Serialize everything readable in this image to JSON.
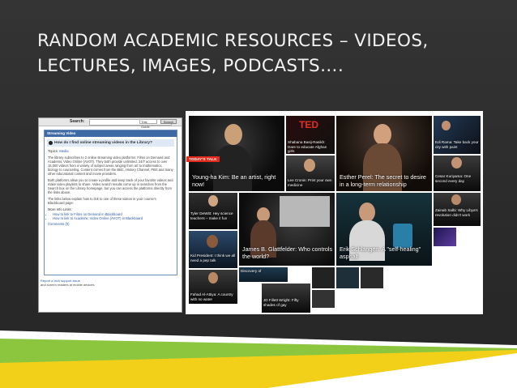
{
  "slide": {
    "title_line1": "RANDOM ACADEMIC RESOURCES – VIDEOS,",
    "title_line2": "LECTURES, IMAGES, PODCASTS…."
  },
  "faq": {
    "search_label": "Search:",
    "scope": "This Guide",
    "search_button": "Search",
    "panel_title": "Streaming Video",
    "question": "How do I find online streaming videos in the Library?",
    "topics_label": "Topics:",
    "topics_value": "Media",
    "paragraph1": "The library subscribes to 2 online streaming video platforms: Films on Demand and Academic Video Online (AVOT). They both provide unlimited, 24/7 access to over 15,000 videos from a variety of subject areas ranging from art to mathematics, biology to counseling. Content comes from the BBC, History Channel, PBS and many other educational content and movie providers.",
    "paragraph2": "Both platforms allow you to create a profile and keep track of your favorite videos and make video playlists to share. Video search results come up in searches from the Search box on the Library homepage, but you can access the platforms directly from the links above.",
    "paragraph3": "The links below explain how to link to one of these videos in your course's Blackboard page:",
    "more_info": "More Info Links:",
    "links": [
      "How to link to Films on Demand in Blackboard",
      "How to link to Academic Video Online (AVOT) in Blackboard"
    ],
    "comments": "Comments (0)",
    "footer_line1": "Report a tech support issue.",
    "footer_line2": "and screen readers at mobile devices"
  },
  "ted": {
    "badge": "TODAY'S TALK",
    "logo": "TED",
    "talks": [
      {
        "id": "young-ha-kim",
        "caption": "Young-ha Kim: Be an artist, right now!"
      },
      {
        "id": "shabana",
        "caption": "Shabana Basij-Rasikh: Dare to educate Afghan girls"
      },
      {
        "id": "lee-cronin",
        "caption": "Lee Cronin: Print your own medicine"
      },
      {
        "id": "esther-perel",
        "caption": "Esther Perel: The secret to desire in a long-term relationship"
      },
      {
        "id": "edi-rama",
        "caption": "Edi Rama: Take back your city with paint"
      },
      {
        "id": "cesar-kuriyama",
        "caption": "Cesar Kuriyama: One second every day"
      },
      {
        "id": "tyler-dewitt",
        "caption": "Tyler DeWitt: Hey science teachers – make it fun"
      },
      {
        "id": "zainab",
        "caption": "Zainab Salbi: Why Libya's revolution didn't work"
      },
      {
        "id": "james-glattfelder",
        "caption": "James B. Glattfelder: Who controls the world?"
      },
      {
        "id": "erik-schlangen",
        "caption": "Erik Schlangen: A \"self-healing\" asphalt"
      },
      {
        "id": "kid-president",
        "caption": "Kid President: I think we all need a pep talk"
      },
      {
        "id": "discovery",
        "caption": "Discovery of"
      },
      {
        "id": "fahad",
        "caption": "Fahad Al-Attiya: A country with no water"
      },
      {
        "id": "fillett",
        "caption": "JD Fillett Wright: Fifty shades of gay"
      }
    ]
  },
  "colors": {
    "background": "#2e2e2e",
    "title_text": "#f2f2f2",
    "ted_red": "#e62b1e",
    "stripe_green": "#8cc63f",
    "stripe_yellow": "#f2d01a",
    "stripe_white": "#ffffff"
  }
}
